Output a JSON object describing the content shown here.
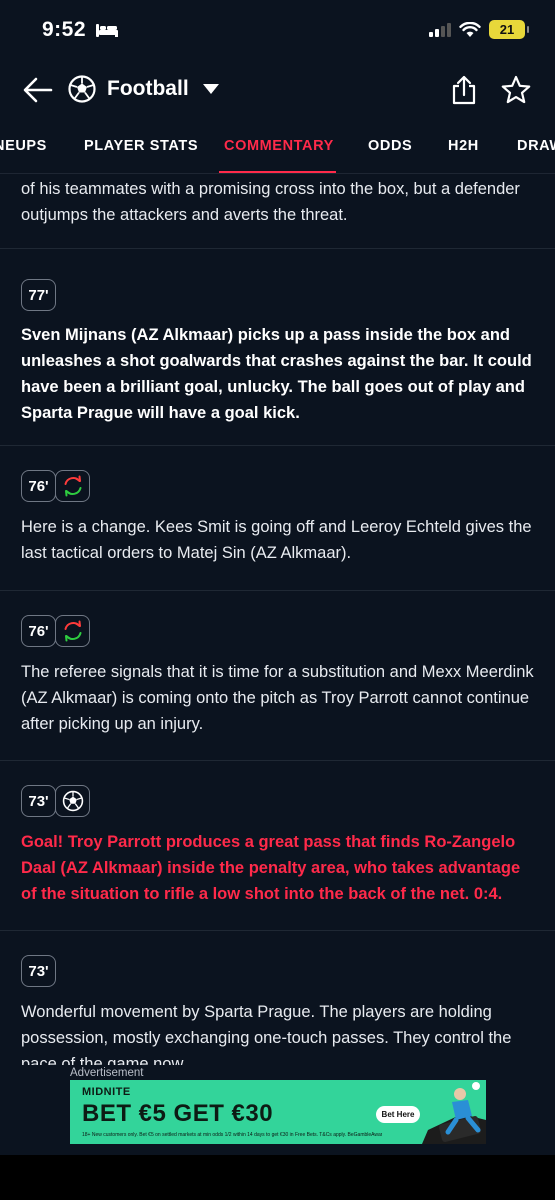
{
  "status_bar": {
    "time": "9:52",
    "battery": "21"
  },
  "header": {
    "title": "Football"
  },
  "tabs": [
    {
      "label": "NEUPS"
    },
    {
      "label": "PLAYER STATS"
    },
    {
      "label": "COMMENTARY"
    },
    {
      "label": "ODDS"
    },
    {
      "label": "H2H"
    },
    {
      "label": "DRAW"
    }
  ],
  "commentary": [
    {
      "minute": "",
      "style": "normal",
      "text": "of his teammates with a promising cross into the box, but a defender outjumps the attackers and averts the threat."
    },
    {
      "minute": "77'",
      "style": "bold",
      "text": "Sven Mijnans (AZ Alkmaar) picks up a pass inside the box and unleashes a shot goalwards that crashes against the bar. It could have been a brilliant goal, unlucky. The ball goes out of play and Sparta Prague will have a goal kick."
    },
    {
      "minute": "76'",
      "icon": "substitution-icon",
      "style": "normal",
      "text": "Here is a change. Kees Smit is going off and Leeroy Echteld gives the last tactical orders to Matej Sin (AZ Alkmaar)."
    },
    {
      "minute": "76'",
      "icon": "substitution-icon",
      "style": "normal",
      "text": "The referee signals that it is time for a substitution and Mexx Meerdink (AZ Alkmaar) is coming onto the pitch as Troy Parrott cannot continue after picking up an injury."
    },
    {
      "minute": "73'",
      "icon": "football-icon",
      "style": "goal",
      "text": "Goal! Troy Parrott produces a great pass that finds Ro-Zangelo Daal (AZ Alkmaar) inside the penalty area, who takes advantage of the situation to rifle a low shot into the back of the net. 0:4."
    },
    {
      "minute": "73'",
      "style": "normal",
      "text": "Wonderful movement by Sparta Prague. The players are holding possession, mostly exchanging one-touch passes. They control the pace of the game now."
    }
  ],
  "ad": {
    "label": "Advertisement",
    "brand": "MIDNITE",
    "headline": "BET €5 GET €30",
    "cta": "Bet Here",
    "fine_print": "18+ New customers only. Bet €5 on settled markets at min odds 1/2 within 14 days to get €30 in Free Bets. T&Cs apply. BeGambleAware.org"
  },
  "colors": {
    "background": "#0b131f",
    "accent": "#ff2a4a",
    "ad_green": "#33d49a"
  }
}
